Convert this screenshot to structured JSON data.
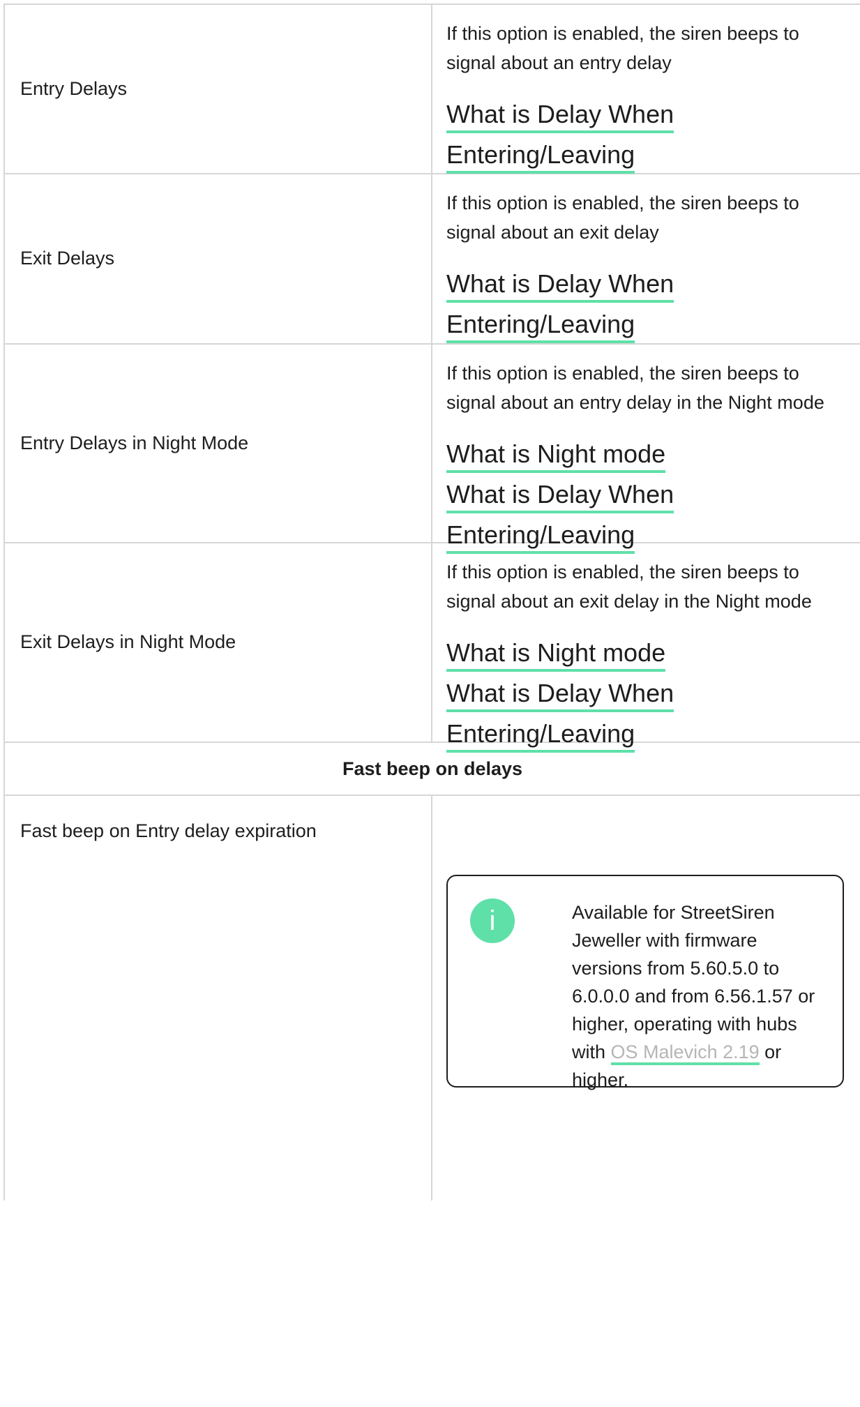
{
  "rows": [
    {
      "label": "Entry Delays",
      "description": "If this option is enabled, the siren beeps to signal about an entry delay",
      "links": [
        "What is Delay When",
        "Entering/Leaving"
      ]
    },
    {
      "label": "Exit Delays",
      "description": "If this option is enabled, the siren beeps to signal about an exit delay",
      "links": [
        "What is Delay When",
        "Entering/Leaving"
      ]
    },
    {
      "label": "Entry Delays in Night Mode",
      "description": "If this option is enabled, the siren beeps to signal about an entry delay in the Night mode",
      "links": [
        "What is Night mode",
        "What is Delay When",
        "Entering/Leaving"
      ]
    },
    {
      "label": "Exit Delays in Night Mode",
      "description": "If this option is enabled, the siren beeps to signal about an exit delay in the Night mode",
      "links": [
        "What is Night mode",
        "What is Delay When",
        "Entering/Leaving"
      ]
    }
  ],
  "section_heading": "Fast beep on delays",
  "last_row": {
    "label": "Fast beep on Entry delay expiration",
    "note": {
      "icon": "info-icon",
      "icon_glyph": "i",
      "text_before": "Available for StreetSiren Jeweller with firmware versions from 5.60.5.0 to 6.0.0.0 and from 6.56.1.57 or higher, operating with hubs with ",
      "link_text": "OS Malevich 2.19",
      "text_after": " or higher."
    }
  },
  "colors": {
    "accent": "#5fe0a8",
    "border": "#d6d6d6",
    "text": "#1d1d1d",
    "link_muted": "#b5b5b5"
  }
}
